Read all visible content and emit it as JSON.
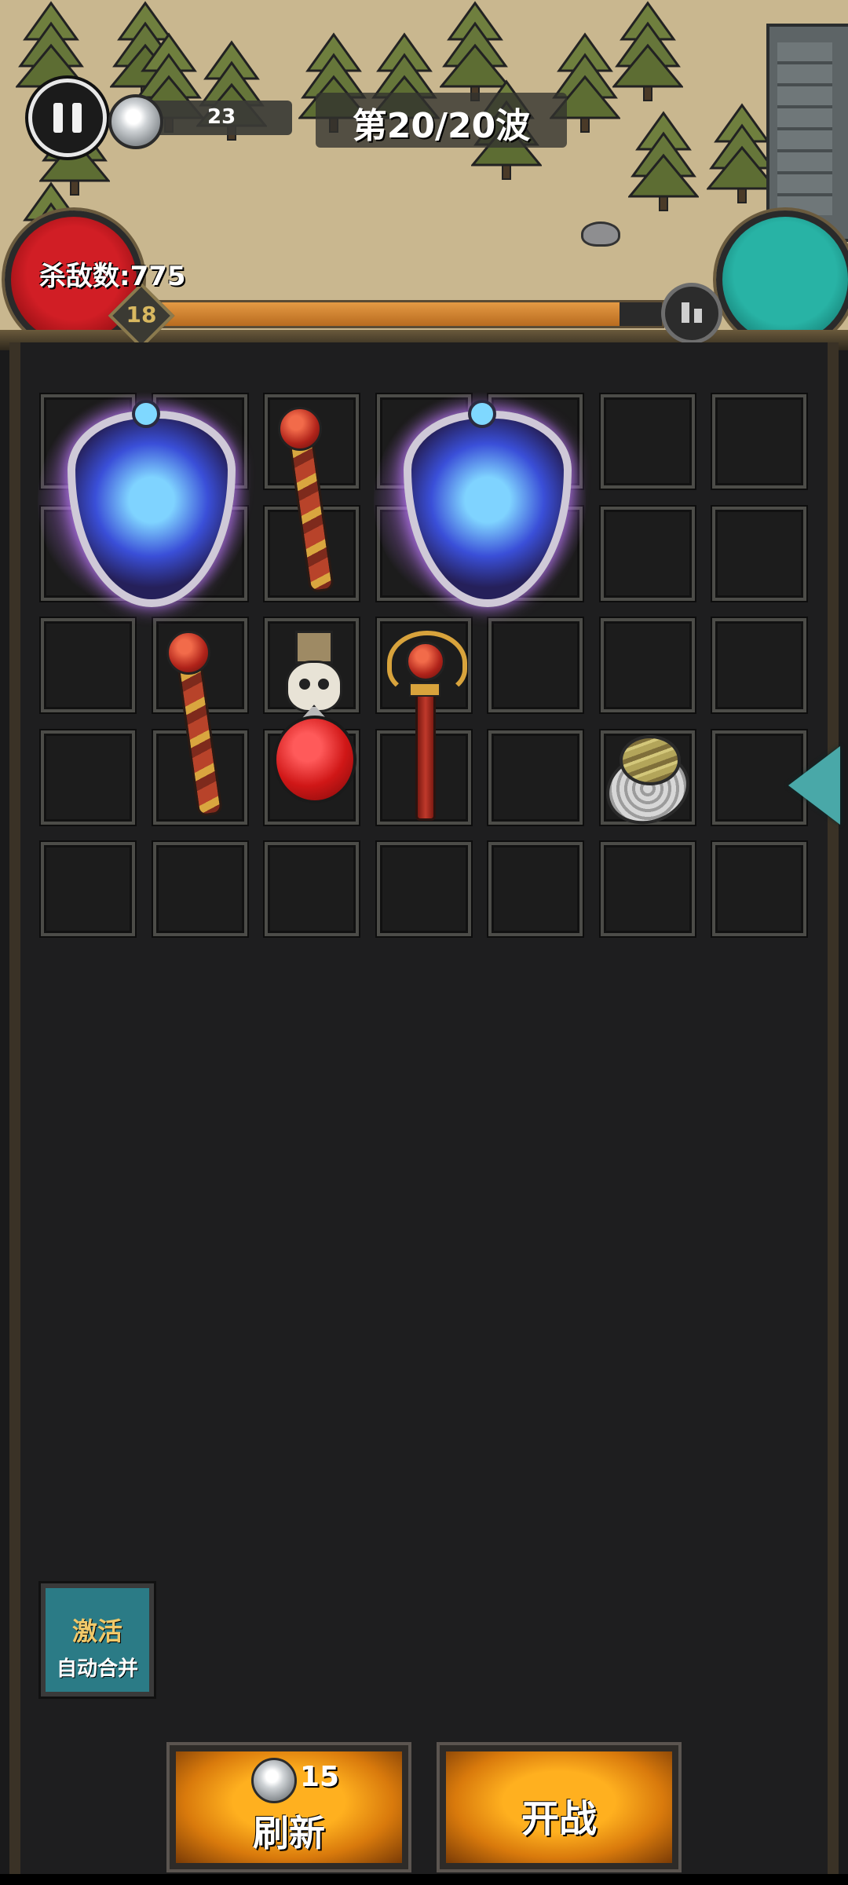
{
  "hud": {
    "coins": "23",
    "wave": "第20/20波",
    "kills": "杀敌数:775",
    "level": "18",
    "xp_progress": 0.92
  },
  "inventory": {
    "rows": 5,
    "cols": 7,
    "items": [
      {
        "name": "shield-item",
        "type": "shield",
        "row": 0,
        "col": 0,
        "rows": 2,
        "cols": 2
      },
      {
        "name": "staff-item",
        "type": "staff-twist",
        "row": 0,
        "col": 2,
        "rows": 2,
        "cols": 1
      },
      {
        "name": "shield-item",
        "type": "shield",
        "row": 0,
        "col": 3,
        "rows": 2,
        "cols": 2
      },
      {
        "name": "staff-item",
        "type": "staff-twist",
        "row": 2,
        "col": 1,
        "rows": 2,
        "cols": 1
      },
      {
        "name": "skull-potion-item",
        "type": "potion",
        "row": 2,
        "col": 2,
        "rows": 2,
        "cols": 1
      },
      {
        "name": "scepter-item",
        "type": "scepter",
        "row": 2,
        "col": 3,
        "rows": 2,
        "cols": 1
      },
      {
        "name": "ring-item",
        "type": "ring",
        "row": 3,
        "col": 5,
        "rows": 1,
        "cols": 1
      }
    ]
  },
  "auto_merge": {
    "line1": "激活",
    "line2": "自动合并"
  },
  "refresh": {
    "cost": "15",
    "label": "刷新"
  },
  "fight": {
    "label": "开战"
  },
  "colors": {
    "xp": "#e59a44",
    "health_orb": "#d11e25",
    "mana_orb": "#28b3a5",
    "button_gold": "#ffb01f"
  },
  "icons": [
    "pause-icon",
    "silver-coin-icon",
    "stats-icon",
    "expand-arrow-icon"
  ]
}
